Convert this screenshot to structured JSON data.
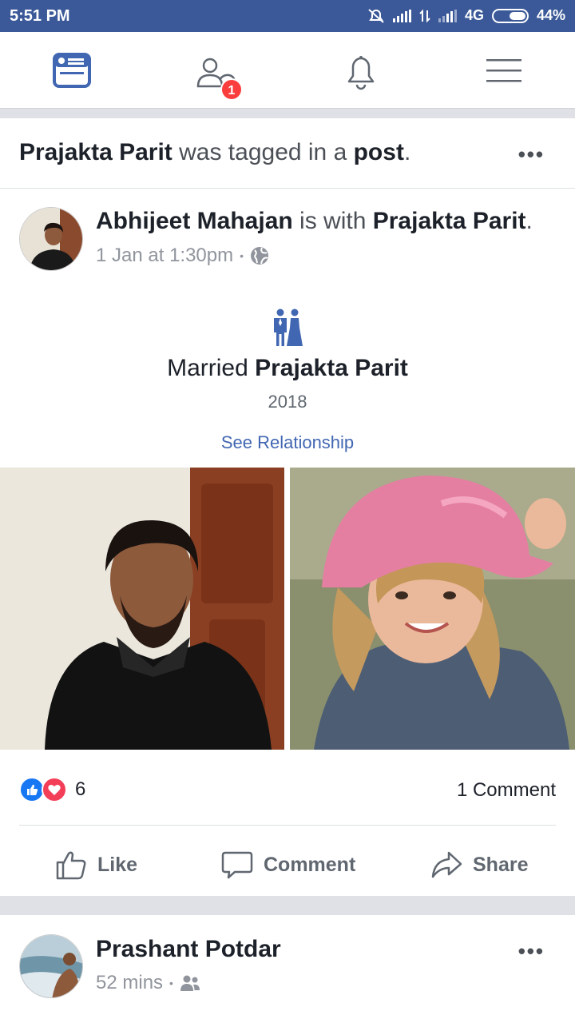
{
  "status_bar": {
    "time": "5:51 PM",
    "network": "4G",
    "battery": "44%"
  },
  "nav": {
    "friend_requests_badge": "1"
  },
  "tag_story": {
    "tagged_name": "Prajakta Parit",
    "text_mid": " was tagged in a ",
    "post_word": "post",
    "period": ".",
    "more": "•••"
  },
  "post": {
    "author": "Abhijeet Mahajan",
    "with_text": " is with ",
    "with_name": "Prajakta Parit",
    "period": ".",
    "timestamp": "1 Jan at 1:30pm",
    "sep": "•",
    "life_event": {
      "married_word": "Married ",
      "partner": "Prajakta Parit",
      "year": "2018",
      "link": "See Relationship"
    },
    "reaction_count": "6",
    "comment_count": "1 Comment",
    "actions": {
      "like": "Like",
      "comment": "Comment",
      "share": "Share"
    }
  },
  "next_post": {
    "author": "Prashant Potdar",
    "timestamp": "52 mins",
    "sep": "•",
    "more": "•••"
  },
  "colors": {
    "brand": "#3b5998",
    "link": "#4267b2",
    "like": "#1877f2",
    "love": "#f33e58",
    "badge": "#fa3e3e"
  }
}
